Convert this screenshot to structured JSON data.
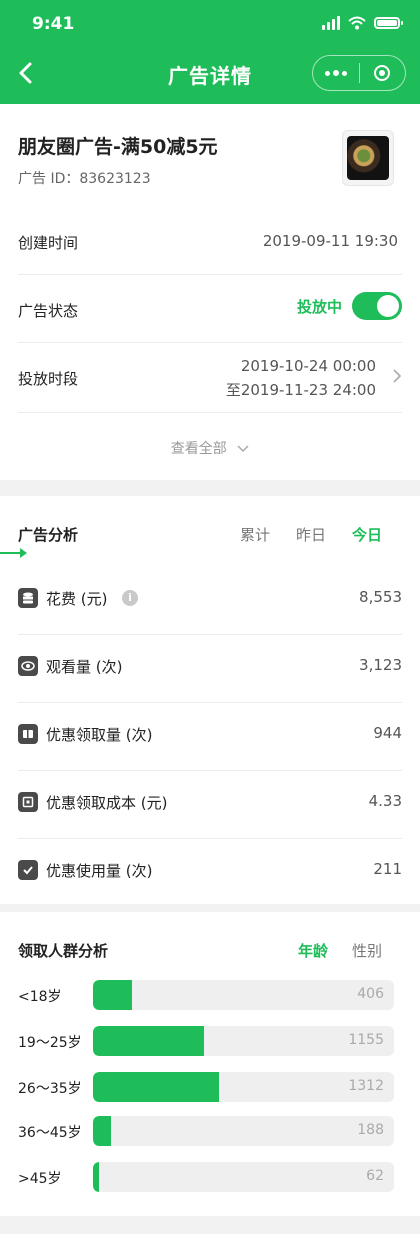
{
  "status": {
    "time": "9:41"
  },
  "nav": {
    "title": "广告详情"
  },
  "ad": {
    "title": "朋友圈广告-满50减5元",
    "id_text": "广告 ID：83623123"
  },
  "details": {
    "created_label": "创建时间",
    "created_value": "2019-09-11 19:30",
    "status_label": "广告状态",
    "status_value": "投放中",
    "status_on": true,
    "period_label": "投放时段",
    "period_start": "2019-10-24 00:00",
    "period_end": "至2019-11-23 24:00",
    "see_all": "查看全部"
  },
  "analysis": {
    "title": "广告分析",
    "tabs": [
      "累计",
      "昨日",
      "今日"
    ],
    "active_tab": "今日",
    "metrics": [
      {
        "icon": "database-icon",
        "label": "花费 (元)",
        "value": "8,553"
      },
      {
        "icon": "eye-icon",
        "label": "观看量 (次)",
        "value": "3,123"
      },
      {
        "icon": "ticket-icon",
        "label": "优惠领取量 (次)",
        "value": "944"
      },
      {
        "icon": "wallet-icon",
        "label": "优惠领取成本 (元)",
        "value": "4.33"
      },
      {
        "icon": "check-icon",
        "label": "优惠使用量 (次)",
        "value": "211"
      }
    ]
  },
  "audience": {
    "title": "领取人群分析",
    "tabs": [
      "年龄",
      "性别"
    ],
    "active_tab": "年龄",
    "groups": [
      {
        "label": "<18岁",
        "value": 406,
        "fill": 0.13
      },
      {
        "label": "19～25岁",
        "value": 1155,
        "fill": 0.37
      },
      {
        "label": "26～35岁",
        "value": 1312,
        "fill": 0.42
      },
      {
        "label": "36～45岁",
        "value": 188,
        "fill": 0.06
      },
      {
        "label": ">45岁",
        "value": 62,
        "fill": 0.02
      }
    ]
  },
  "colors": {
    "brand": "#1fbd5a",
    "bar_track": "#efefef"
  }
}
